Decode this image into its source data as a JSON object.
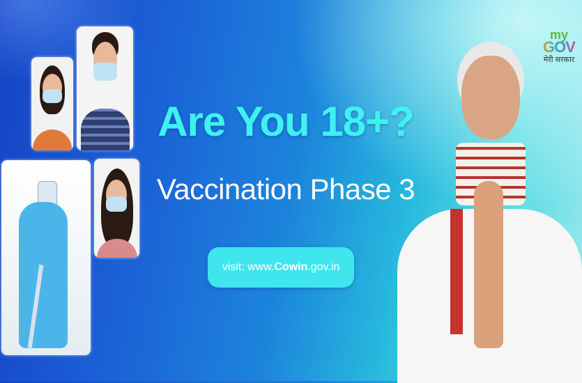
{
  "headline": "Are You 18+?",
  "subheadline": "Vaccination Phase 3",
  "cta": {
    "prefix": "visit: www.",
    "brand": "Cowin",
    "suffix": ".gov.in"
  },
  "logo": {
    "my": "my",
    "gov": "GOV",
    "hindi": "मेरी सरकार"
  },
  "colors": {
    "accent": "#3ff2f0",
    "button": "#3fe6ee",
    "bg_dark": "#1543c4",
    "bg_light": "#9fe9ee"
  }
}
